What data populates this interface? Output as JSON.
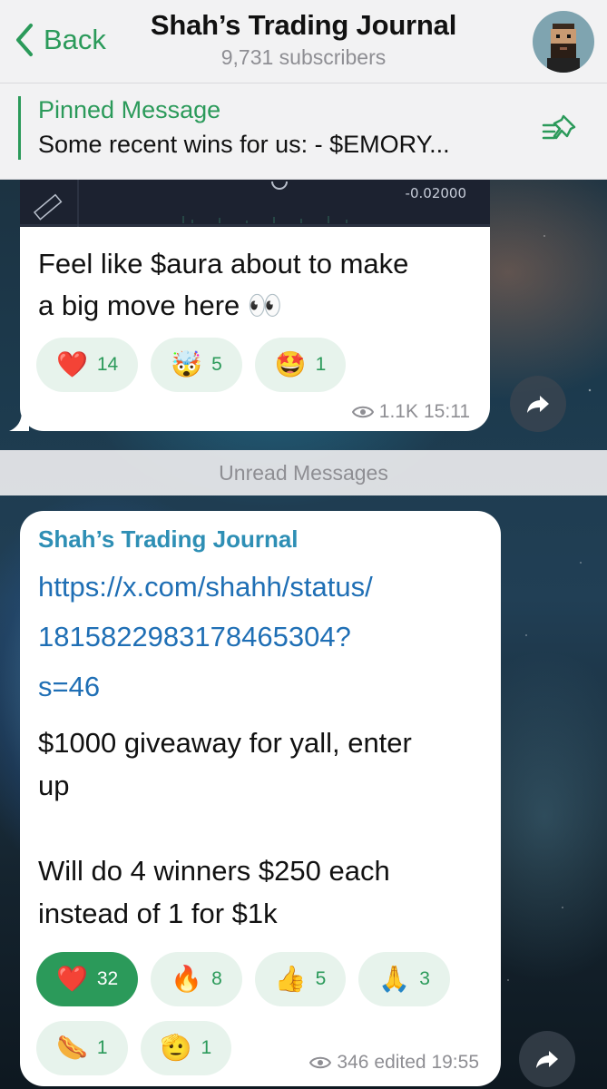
{
  "header": {
    "back_label": "Back",
    "title": "Shah’s Trading Journal",
    "subtitle": "9,731 subscribers"
  },
  "pinned": {
    "label": "Pinned Message",
    "text": "Some recent wins for us: - $EMORY..."
  },
  "message1": {
    "chart_tick": "-0.02000",
    "text_line1": "Feel like $aura about to make",
    "text_line2": "a big move here 👀",
    "reactions": [
      {
        "emoji": "❤️",
        "count": "14"
      },
      {
        "emoji": "🤯",
        "count": "5"
      },
      {
        "emoji": "🤩",
        "count": "1"
      }
    ],
    "views": "1.1K",
    "time": "15:11"
  },
  "divider": {
    "label": "Unread Messages"
  },
  "message2": {
    "sender": "Shah’s Trading Journal",
    "link_line1": "https://x.com/shahh/status/",
    "link_line2": "1815822983178465304?",
    "link_line3": "s=46",
    "body": "$1000 giveaway for yall, enter\nup\n\nWill do 4 winners $250 each\ninstead of 1 for $1k",
    "reactions_row1": [
      {
        "emoji": "❤️",
        "count": "32",
        "selected": true
      },
      {
        "emoji": "🔥",
        "count": "8"
      },
      {
        "emoji": "👍",
        "count": "5"
      },
      {
        "emoji": "🙏",
        "count": "3"
      }
    ],
    "reactions_row2": [
      {
        "emoji": "🌭",
        "count": "1"
      },
      {
        "emoji": "🫡",
        "count": "1"
      }
    ],
    "views": "346",
    "time": "edited 19:55"
  }
}
